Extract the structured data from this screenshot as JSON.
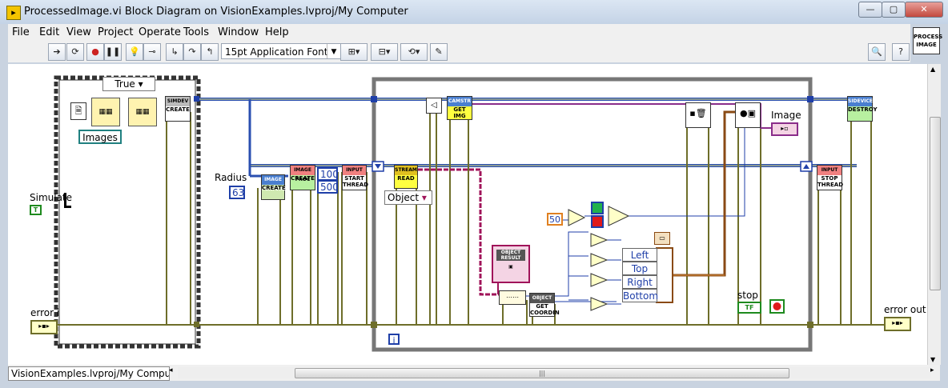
{
  "window": {
    "title": "ProcessedImage.vi Block Diagram on VisionExamples.lvproj/My Computer",
    "buttons": {
      "minimize": "—",
      "maximize": "▢",
      "close": "✕"
    }
  },
  "menu": [
    "File",
    "Edit",
    "View",
    "Project",
    "Operate",
    "Tools",
    "Window",
    "Help"
  ],
  "toolbar": {
    "font": "15pt Application Font",
    "icons": [
      "run-arrow-icon",
      "run-continuous-icon",
      "abort-icon",
      "pause-icon",
      "highlight-execution-icon",
      "retain-wire-values-icon",
      "step-into-icon",
      "step-over-icon",
      "step-out-icon",
      "align-icon",
      "distribute-icon",
      "reorder-icon",
      "cleanup-icon",
      "search-icon",
      "help-icon"
    ]
  },
  "vi_icon": {
    "line1": "PROCESS",
    "line2": "IMAGE"
  },
  "diagram": {
    "case_selector": "True",
    "images_label": "Images",
    "simulate_label": "Simulate",
    "simulate_const": "T",
    "error_in_label": "error i",
    "error_out_label": "error out",
    "radius_label": "Radius",
    "radius_value": "63",
    "const_100": "100",
    "const_500": "500",
    "const_50": "50",
    "object_dropdown": "Object",
    "image_label": "Image",
    "stop_label": "stop",
    "stop_const": "TF",
    "cluster_fields": [
      "Left",
      "Top",
      "Right",
      "Bottom"
    ],
    "info_icon": "i",
    "nodes": {
      "simdev_create": {
        "hdr": "SIMDEV",
        "body": "CREATE"
      },
      "image_feature_create": {
        "hdr": "IMAGE FEATURE",
        "body": "CREATE"
      },
      "image_proc_create": {
        "hdr": "IMAGE PROC",
        "body": "CREATE"
      },
      "input_start_thread": {
        "hdr": "INPUT",
        "body": "START THREAD"
      },
      "stream_read": {
        "hdr": "STREAM",
        "body": "READ"
      },
      "camstr_get_img": {
        "hdr": "CAMSTR",
        "body": "GET IMG"
      },
      "object_result": {
        "hdr": "OBJECT RESULT"
      },
      "object_result_get_coordin": {
        "hdr": "OBJECT RESULT",
        "body": "GET COORDIN"
      },
      "input_stop_thread": {
        "hdr": "INPUT",
        "body": "STOP THREAD"
      },
      "sidevice_destroy": {
        "hdr": "SIDEVICE",
        "body": "DESTROY"
      }
    }
  },
  "status": {
    "project_path": "VisionExamples.lvproj/My Computer",
    "scroll_grip": "|||"
  }
}
